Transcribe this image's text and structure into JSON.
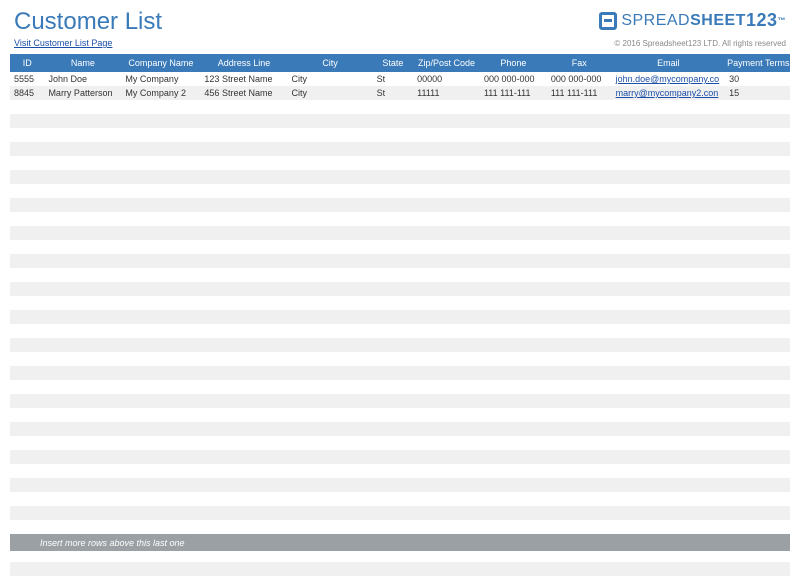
{
  "header": {
    "title": "Customer List",
    "logo_text1": "SPREAD",
    "logo_text2": "SHEET",
    "logo_num": "123"
  },
  "subheader": {
    "visit_link": "Visit Customer List Page",
    "copyright": "© 2016 Spreadsheet123 LTD. All rights reserved"
  },
  "columns": {
    "id": "ID",
    "name": "Name",
    "company": "Company Name",
    "address": "Address Line",
    "city": "City",
    "state": "State",
    "zip": "Zip/Post Code",
    "phone": "Phone",
    "fax": "Fax",
    "email": "Email",
    "terms": "Payment Terms"
  },
  "rows": [
    {
      "id": "5555",
      "name": "John Doe",
      "company": "My Company",
      "address": "123 Street Name",
      "city": "City",
      "state": "St",
      "zip": "00000",
      "phone": "000 000-000",
      "fax": "000 000-000",
      "email": "john.doe@mycompany.co",
      "terms": "30"
    },
    {
      "id": "8845",
      "name": "Marry Patterson",
      "company": "My Company 2",
      "address": "456 Street Name",
      "city": "City",
      "state": "St",
      "zip": "11111",
      "phone": "111 111-111",
      "fax": "111 111-111",
      "email": "marry@mycompany2.con",
      "terms": "15"
    }
  ],
  "empty_rows": 34,
  "footer": {
    "hint": "Insert more rows above this last one"
  }
}
